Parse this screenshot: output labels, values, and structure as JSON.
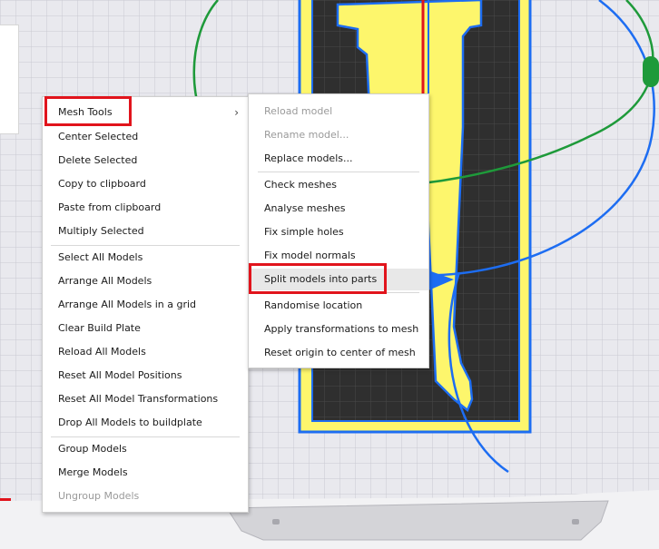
{
  "context_menu": {
    "items": [
      {
        "label": "Mesh Tools",
        "has_submenu": true
      },
      {
        "label": "Center Selected"
      },
      {
        "label": "Delete Selected"
      },
      {
        "label": "Copy to clipboard"
      },
      {
        "label": "Paste from clipboard"
      },
      {
        "label": "Multiply Selected"
      },
      {
        "label": "Select All Models"
      },
      {
        "label": "Arrange All Models"
      },
      {
        "label": "Arrange All Models in a grid"
      },
      {
        "label": "Clear Build Plate"
      },
      {
        "label": "Reload All Models"
      },
      {
        "label": "Reset All Model Positions"
      },
      {
        "label": "Reset All Model Transformations"
      },
      {
        "label": "Drop All Models to buildplate"
      },
      {
        "label": "Group Models"
      },
      {
        "label": "Merge Models"
      },
      {
        "label": "Ungroup Models",
        "disabled": true
      }
    ],
    "submenu_arrow": "›"
  },
  "mesh_tools_submenu": {
    "items": [
      {
        "label": "Reload model",
        "disabled": true
      },
      {
        "label": "Rename model...",
        "disabled": true
      },
      {
        "label": "Replace models..."
      },
      {
        "label": "Check meshes"
      },
      {
        "label": "Analyse meshes"
      },
      {
        "label": "Fix simple holes"
      },
      {
        "label": "Fix model normals"
      },
      {
        "label": "Split models into parts",
        "highlighted": true
      },
      {
        "label": "Randomise location"
      },
      {
        "label": "Apply transformations to mesh"
      },
      {
        "label": "Reset origin to center of mesh"
      }
    ]
  },
  "colors": {
    "annotation_box": "#e1141c",
    "model_fill": "#fdf66c",
    "model_outline": "#1d6df2",
    "build_plate": "#e9e9ee",
    "rotate_ring_green": "#1e9a3a",
    "rotate_ring_blue": "#1d6df2",
    "axis_red": "#e1141c"
  }
}
